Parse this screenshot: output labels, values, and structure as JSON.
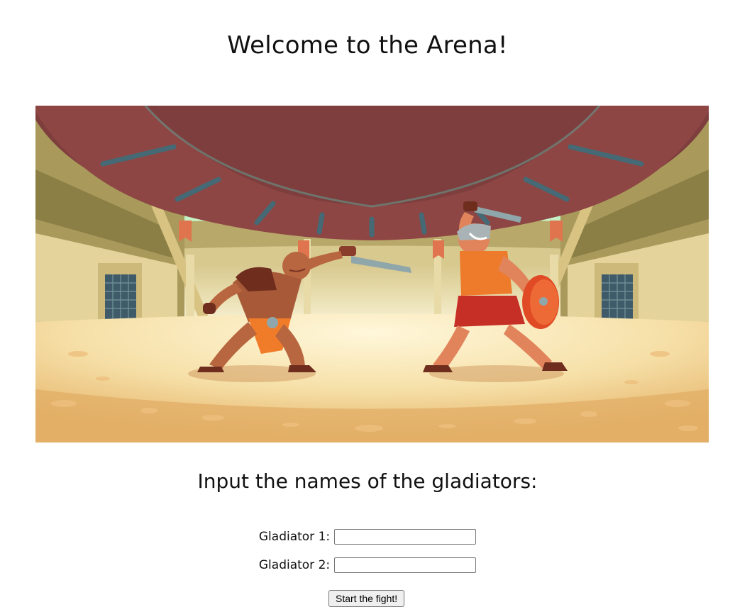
{
  "page": {
    "title": "Welcome to the Arena!",
    "subtitle": "Input the names of the gladiators:"
  },
  "form": {
    "gladiator1_label": "Gladiator 1:",
    "gladiator1_value": "",
    "gladiator2_label": "Gladiator 2:",
    "gladiator2_value": "",
    "submit_label": "Start the fight!"
  },
  "hero_image": {
    "name": "arena-illustration",
    "colors": {
      "sky": "#e8f6c8",
      "sky_edge": "#6ee6c6",
      "awning": "#7e3f3e",
      "sand": "#f7dfa4",
      "wall": "#cbb878"
    }
  }
}
